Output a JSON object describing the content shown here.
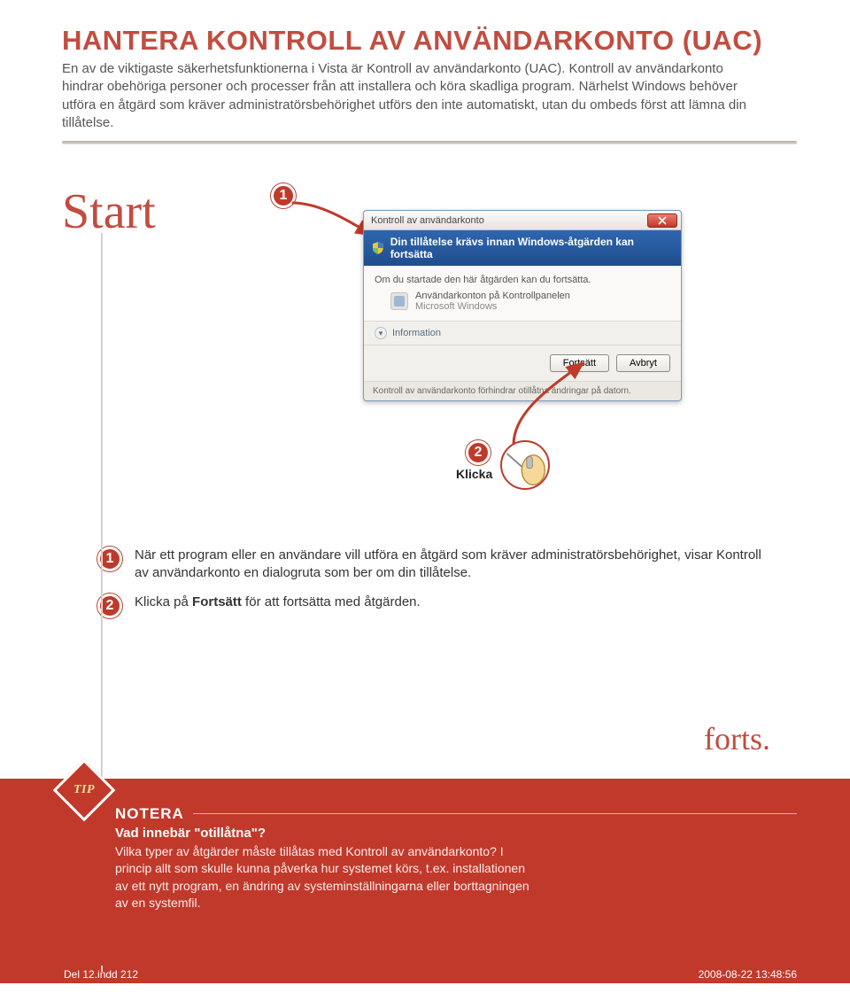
{
  "title": "HANTERA KONTROLL AV ANVÄNDARKONTO (UAC)",
  "intro": "En av de viktigaste säkerhetsfunktionerna i Vista är Kontroll av användarkonto (UAC). Kontroll av användarkonto hindrar obehöriga personer och processer från att installera och köra skadliga program. Närhelst Windows behöver utföra en åtgärd som kräver administratörsbehörighet utförs den inte automatiskt, utan du ombeds först att lämna din tillåtelse.",
  "labels": {
    "start": "Start",
    "klicka": "Klicka",
    "forts": "forts.",
    "tip": "TIP"
  },
  "uac": {
    "windowTitle": "Kontroll av användarkonto",
    "banner": "Din tillåtelse krävs innan Windows-åtgärden kan fortsätta",
    "bodyLead": "Om du startade den här åtgärden kan du fortsätta.",
    "programName": "Användarkonton på Kontrollpanelen",
    "publisher": "Microsoft Windows",
    "infoLabel": "Information",
    "continueBtn": "Fortsätt",
    "cancelBtn": "Avbryt",
    "footerText": "Kontroll av användarkonto förhindrar otillåtna ändringar på datorn."
  },
  "steps": {
    "s1": "När ett program eller en användare vill utföra en åtgärd som kräver administratörsbehörighet, visar Kontroll av användarkonto en dialogruta som ber om din tillåtelse.",
    "s2_pre": "Klicka på ",
    "s2_bold": "Fortsätt",
    "s2_post": " för att fortsätta med åtgärden."
  },
  "note": {
    "heading": "NOTERA",
    "subhead": "Vad innebär \"otillåtna\"?",
    "body": "Vilka typer av åtgärder måste tillåtas med Kontroll av användarkonto? I princip allt som skulle kunna påverka hur systemet körs, t.ex. installationen av ett nytt program, en ändring av systeminställningarna eller borttagningen av en systemfil."
  },
  "footer": {
    "left": "Del 12.indd   212",
    "right": "2008-08-22   13:48:56"
  }
}
